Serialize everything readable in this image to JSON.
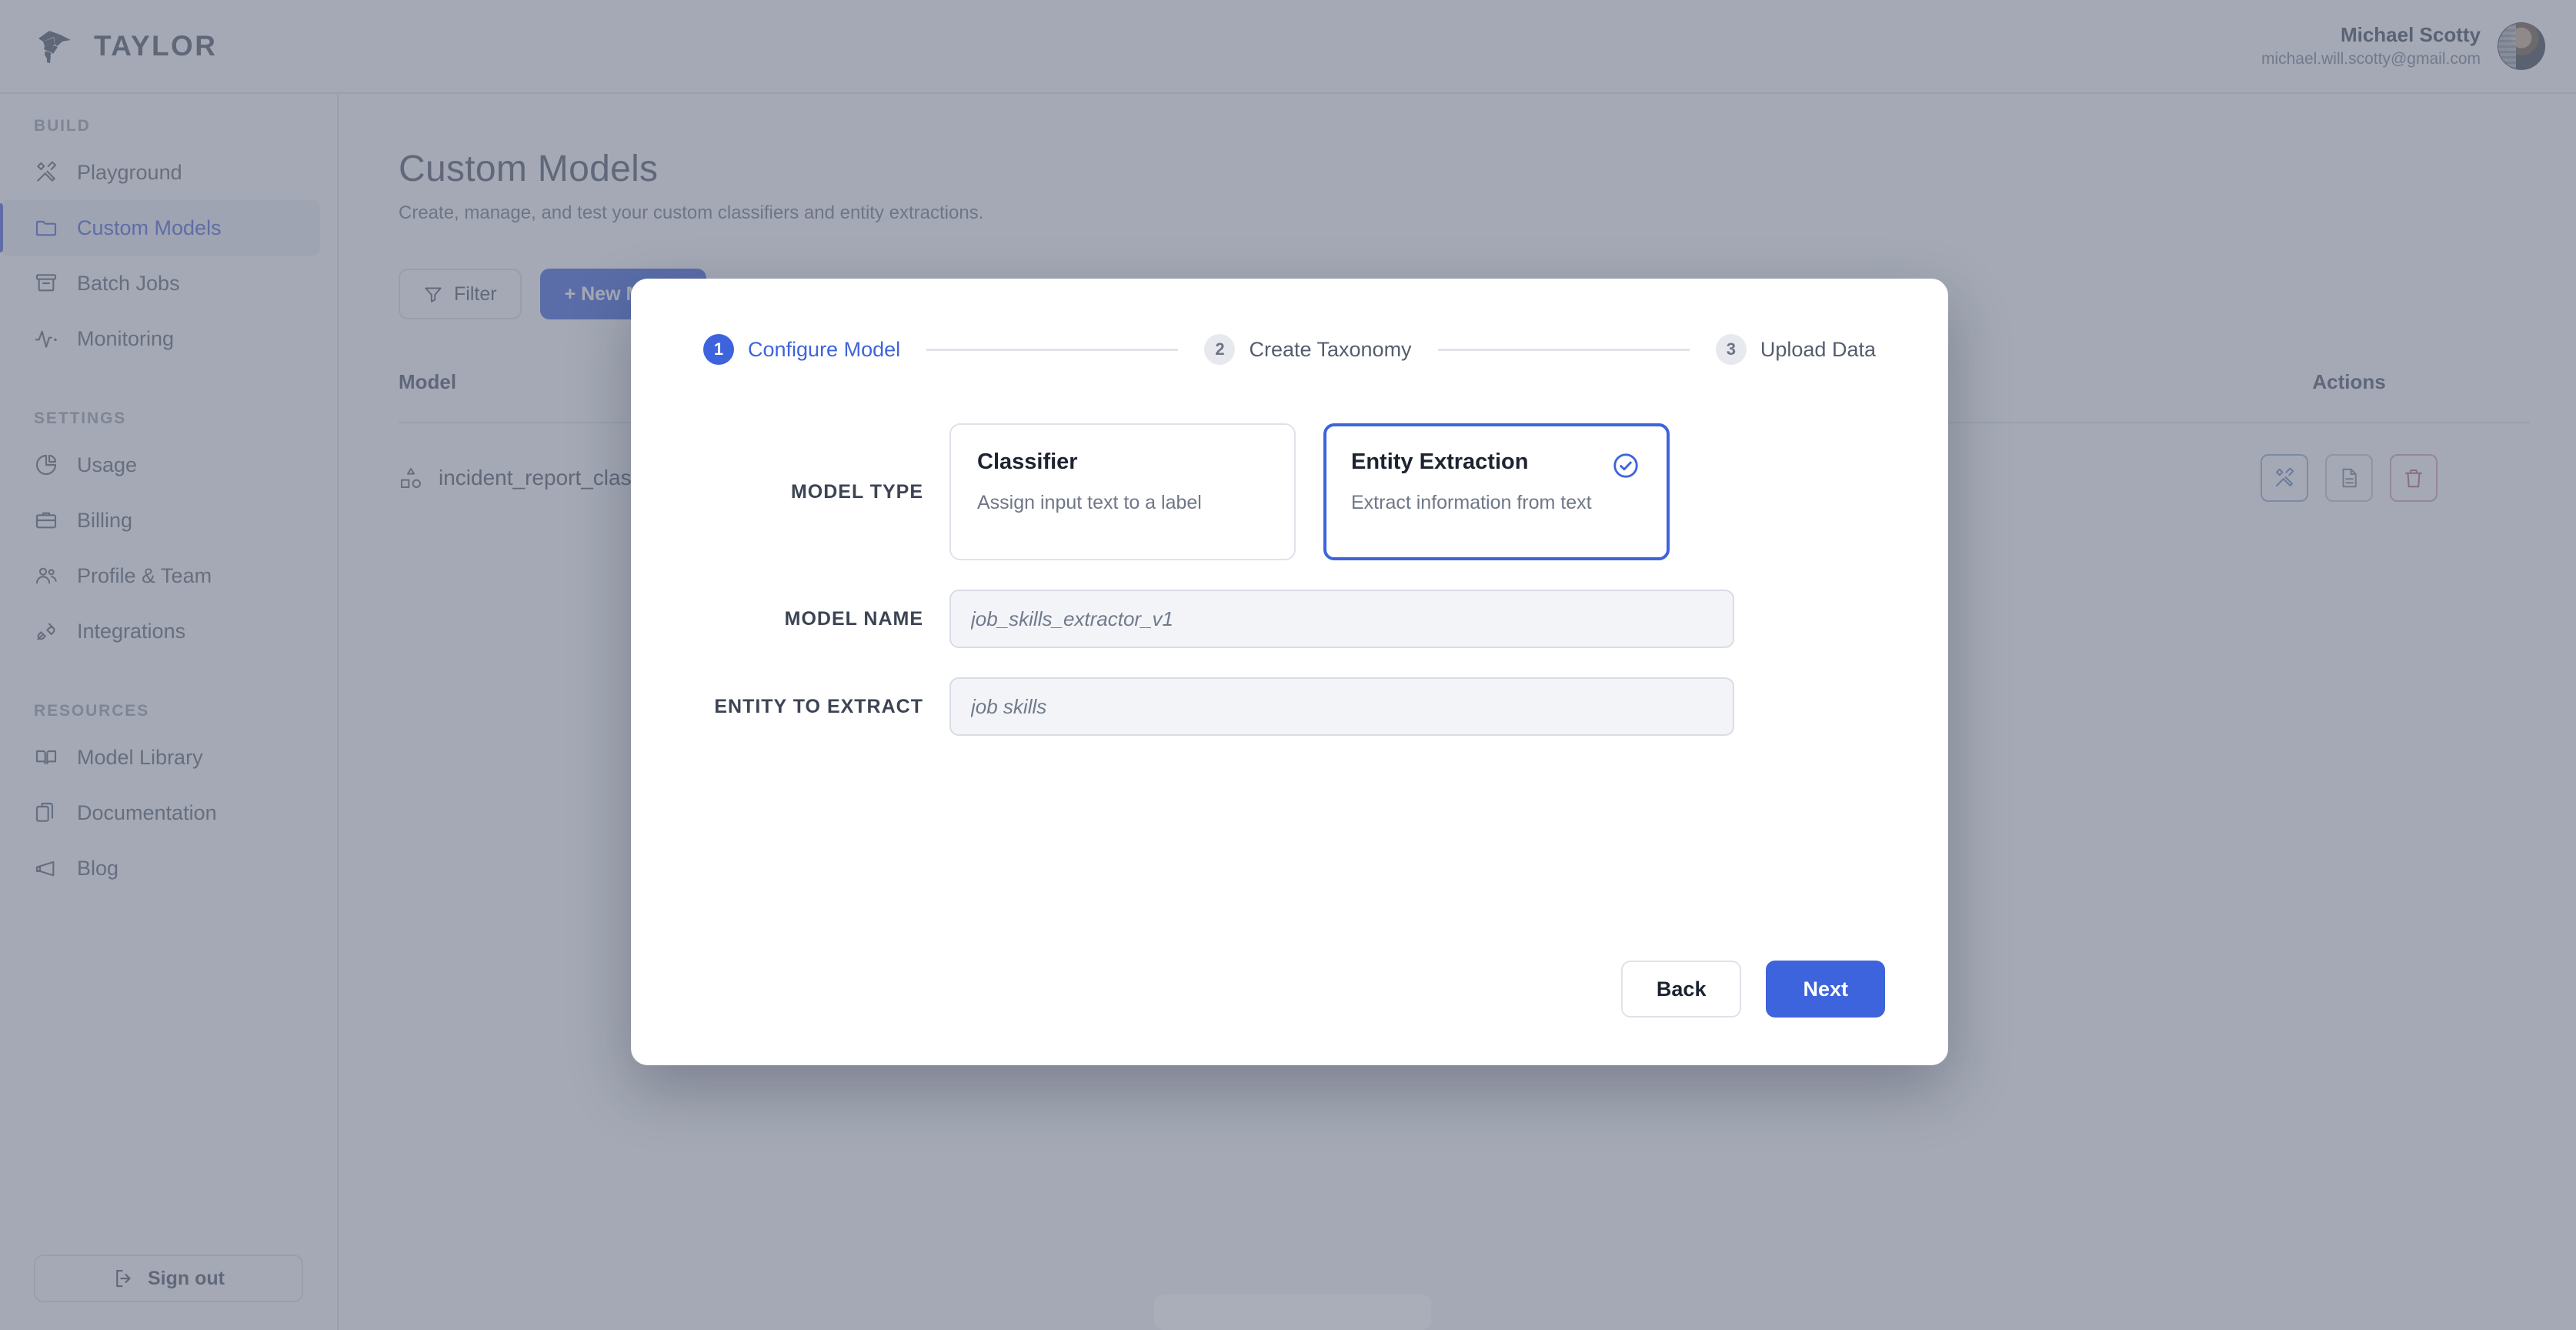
{
  "header": {
    "brand_name": "TAYLOR",
    "brand_icon": "dolphin-logo-icon",
    "user_name": "Michael Scotty",
    "user_email": "michael.will.scotty@gmail.com",
    "avatar_icon": "user-avatar"
  },
  "sidebar": {
    "groups": [
      {
        "label": "BUILD",
        "items": [
          {
            "label": "Playground",
            "icon": "tools-icon",
            "active": false
          },
          {
            "label": "Custom Models",
            "icon": "folder-icon",
            "active": true
          },
          {
            "label": "Batch Jobs",
            "icon": "archive-icon",
            "active": false
          },
          {
            "label": "Monitoring",
            "icon": "activity-pulse-icon",
            "active": false
          }
        ]
      },
      {
        "label": "SETTINGS",
        "items": [
          {
            "label": "Usage",
            "icon": "pie-chart-icon",
            "active": false
          },
          {
            "label": "Billing",
            "icon": "briefcase-icon",
            "active": false
          },
          {
            "label": "Profile & Team",
            "icon": "users-icon",
            "active": false
          },
          {
            "label": "Integrations",
            "icon": "plug-icon",
            "active": false
          }
        ]
      },
      {
        "label": "RESOURCES",
        "items": [
          {
            "label": "Model Library",
            "icon": "book-icon",
            "active": false
          },
          {
            "label": "Documentation",
            "icon": "documents-icon",
            "active": false
          },
          {
            "label": "Blog",
            "icon": "megaphone-icon",
            "active": false
          }
        ]
      }
    ],
    "signout_label": "Sign out",
    "signout_icon": "sign-out-icon"
  },
  "page": {
    "title": "Custom Models",
    "subtitle": "Create, manage, and test your custom classifiers and entity extractions.",
    "filter_label": "Filter",
    "filter_icon": "funnel-icon",
    "new_model_label": "+ New Model",
    "table": {
      "columns": [
        "Model",
        "Actions"
      ],
      "rows": [
        {
          "model_name": "incident_report_classifier",
          "model_icon": "shapes-icon",
          "actions": [
            {
              "icon": "tools-icon",
              "tone": "blue"
            },
            {
              "icon": "document-icon",
              "tone": "gray"
            },
            {
              "icon": "trash-icon",
              "tone": "red"
            }
          ]
        }
      ]
    }
  },
  "modal": {
    "steps": [
      {
        "number": "1",
        "label": "Configure Model",
        "active": true
      },
      {
        "number": "2",
        "label": "Create Taxonomy",
        "active": false
      },
      {
        "number": "3",
        "label": "Upload Data",
        "active": false
      }
    ],
    "model_type_label": "MODEL TYPE",
    "type_cards": [
      {
        "title": "Classifier",
        "description": "Assign input text to a label",
        "selected": false
      },
      {
        "title": "Entity Extraction",
        "description": "Extract information from text",
        "selected": true,
        "check_icon": "circle-check-icon"
      }
    ],
    "model_name_label": "MODEL NAME",
    "model_name_value": "",
    "model_name_placeholder": "job_skills_extractor_v1",
    "entity_label": "ENTITY TO EXTRACT",
    "entity_value": "",
    "entity_placeholder": "job skills",
    "back_label": "Back",
    "next_label": "Next"
  },
  "colors": {
    "accent_blue": "#3d63dd",
    "sidebar_active_bg": "#eef1f8",
    "input_bg": "#f2f4f7",
    "danger_red": "#d8a7a7"
  }
}
